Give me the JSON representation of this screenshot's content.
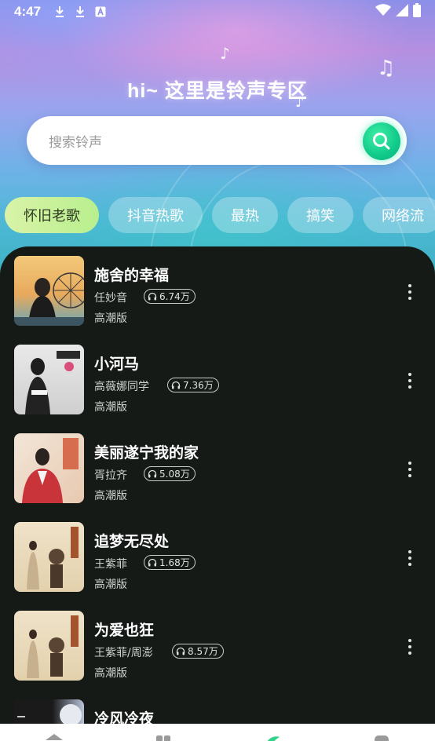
{
  "status": {
    "time": "4:47"
  },
  "hero": {
    "title": "hi~ 这里是铃声专区"
  },
  "search": {
    "placeholder": "搜索铃声"
  },
  "categories": [
    {
      "label": "怀旧老歌",
      "active": true
    },
    {
      "label": "抖音热歌",
      "active": false
    },
    {
      "label": "最热",
      "active": false
    },
    {
      "label": "搞笑",
      "active": false
    },
    {
      "label": "网络流",
      "active": false
    }
  ],
  "songs": [
    {
      "title": "施舍的幸福",
      "artist": "任妙音",
      "plays": "6.74万",
      "version": "高潮版"
    },
    {
      "title": "小河马",
      "artist": "高薇娜同学",
      "plays": "7.36万",
      "version": "高潮版"
    },
    {
      "title": "美丽遂宁我的家",
      "artist": "胥拉齐",
      "plays": "5.08万",
      "version": "高潮版"
    },
    {
      "title": "追梦无尽处",
      "artist": "王紫菲",
      "plays": "1.68万",
      "version": "高潮版"
    },
    {
      "title": "为爱也狂",
      "artist": "王紫菲/周澎",
      "plays": "8.57万",
      "version": "高潮版"
    },
    {
      "title": "冷风冷夜",
      "artist": "",
      "plays": "",
      "version": ""
    }
  ],
  "icons": {
    "download": "download-icon",
    "a11y": "text-a-icon",
    "wifi": "wifi-icon",
    "signal": "signal-icon",
    "battery": "battery-icon",
    "search": "search-icon",
    "headphones": "headphones-icon",
    "more": "more-vertical-icon"
  },
  "colors": {
    "accent": "#10c98a",
    "chip_active": "#c8f09a",
    "panel": "#151a17"
  }
}
